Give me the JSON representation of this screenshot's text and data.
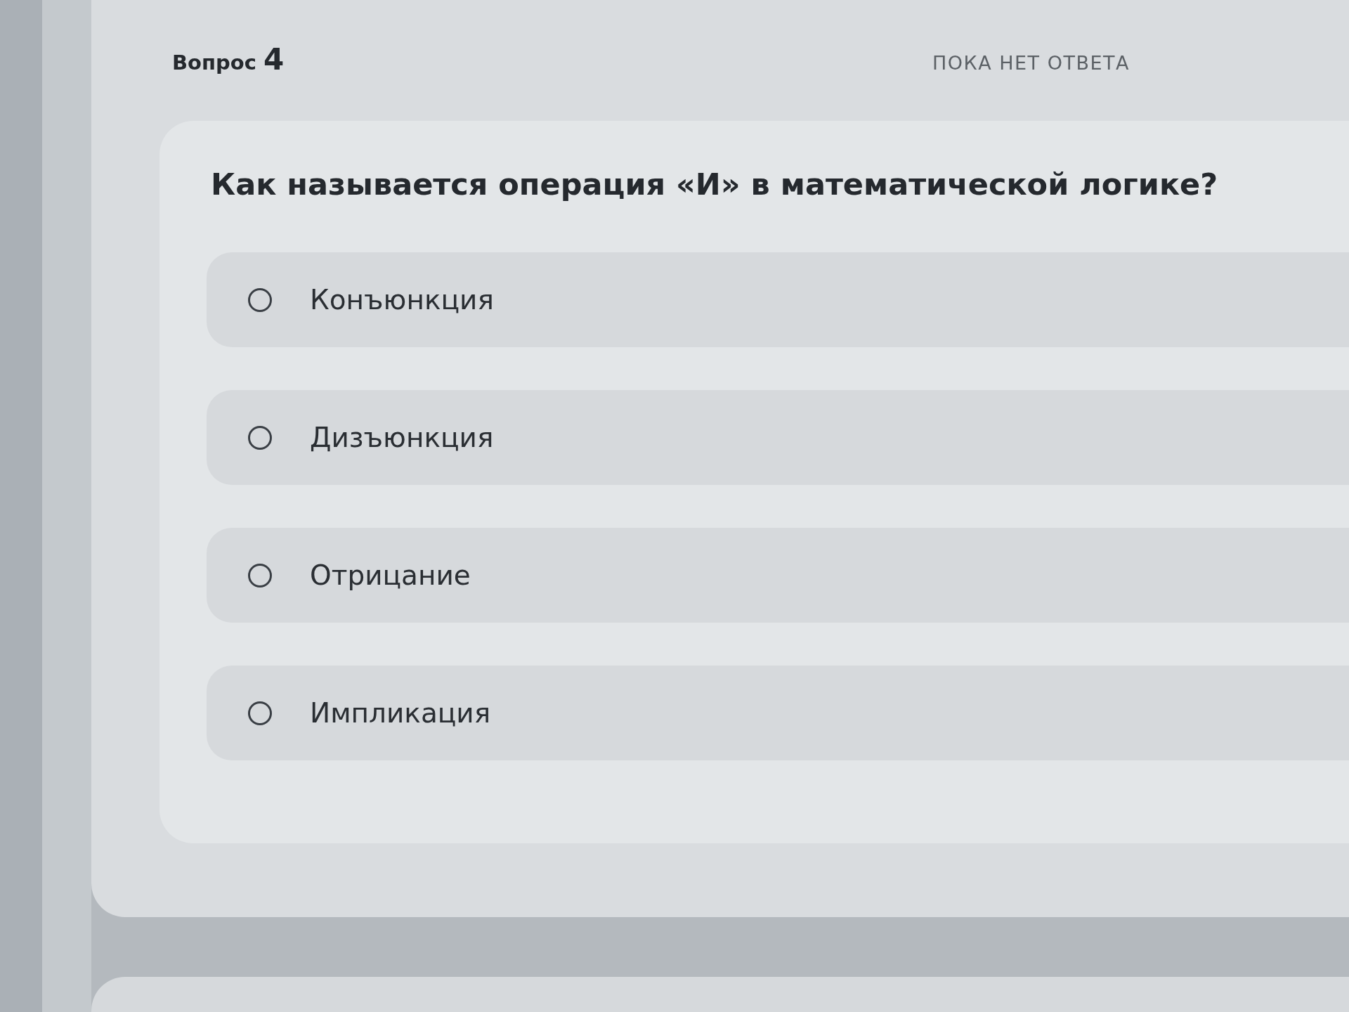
{
  "question": {
    "label": "Вопрос",
    "number": "4",
    "status": "ПОКА НЕТ ОТВЕТА",
    "text": "Как называется операция «И» в математической логике?",
    "options": [
      {
        "label": "Конъюнкция",
        "selected": false
      },
      {
        "label": "Дизъюнкция",
        "selected": false
      },
      {
        "label": "Отрицание",
        "selected": false
      },
      {
        "label": "Импликация",
        "selected": false
      }
    ]
  }
}
